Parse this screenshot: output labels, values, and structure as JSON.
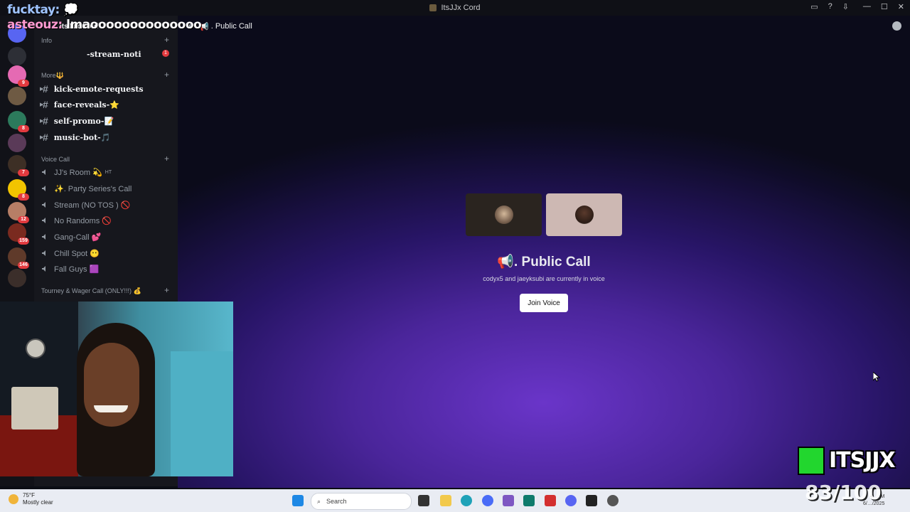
{
  "window": {
    "title": "ItsJJx Cord"
  },
  "overlay_chat": [
    {
      "user": "fucktay:",
      "message": ""
    },
    {
      "user": "asteouz:",
      "message": "lmaoooooooooooooo"
    }
  ],
  "server": {
    "name": "ItsJJx Cord"
  },
  "servers": [
    {
      "badge": ""
    },
    {
      "badge": "9"
    },
    {
      "badge": ""
    },
    {
      "badge": "8"
    },
    {
      "badge": ""
    },
    {
      "badge": "7"
    },
    {
      "badge": "8"
    },
    {
      "badge": "12"
    },
    {
      "badge": "159"
    },
    {
      "badge": "146"
    },
    {
      "badge": ""
    }
  ],
  "sidebar": {
    "info_category": "Info",
    "stream_channel": {
      "label": "-stream-noti",
      "badge": "1"
    },
    "more_category": "More🔱",
    "text_channels": [
      {
        "label": "kick-emote-requests"
      },
      {
        "label": "face-reveals-⭐"
      },
      {
        "label": "self-promo-📝"
      },
      {
        "label": "music-bot-🎵"
      }
    ],
    "voice_category": "Voice Call",
    "voice_channels": [
      {
        "label": "JJ's Room 💫",
        "extra": "HT"
      },
      {
        "label": "✨. Party Series's Call",
        "extra": ""
      },
      {
        "label": "Stream (NO TOS ) 🚫",
        "extra": ""
      },
      {
        "label": "No Randoms 🚫",
        "extra": ""
      },
      {
        "label": "Gang-Call 💕",
        "extra": ""
      },
      {
        "label": "Chill Spot 😶",
        "extra": ""
      },
      {
        "label": "Fall Guys 🟪",
        "extra": ""
      }
    ],
    "tourney_category": "Tourney & Wager Call (ONLY!!!) 💰"
  },
  "main": {
    "header_title": ". Public Call",
    "call_title": ". Public Call",
    "call_subtitle": "codyx5 and jaeyksubi are currently in voice",
    "join_label": "Join Voice"
  },
  "taskbar": {
    "weather_temp": "75°F",
    "weather_desc": "Mostly clear",
    "search_placeholder": "Search",
    "clock_time": "4:… M",
    "clock_date": "6/…/2025"
  },
  "watermark": {
    "brand": "ITSJJX",
    "score": "83/100"
  },
  "colors": {
    "accent": "#5865f2",
    "badge": "#e23a3f",
    "join_bg": "#ffffff"
  }
}
